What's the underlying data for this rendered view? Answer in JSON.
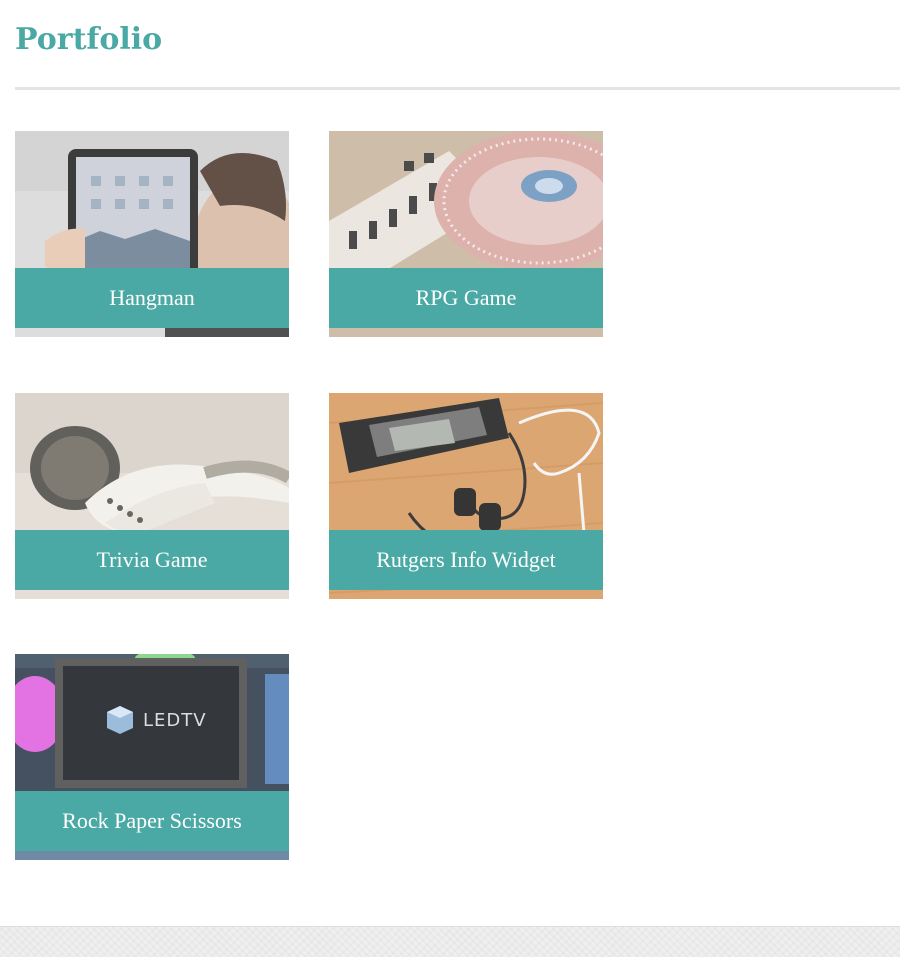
{
  "page": {
    "title": "Portfolio"
  },
  "portfolio": {
    "items": [
      {
        "label": "Hangman",
        "image": "tablet-photo"
      },
      {
        "label": "RPG Game",
        "image": "turntable-photo"
      },
      {
        "label": "Trivia Game",
        "image": "earbuds-photo"
      },
      {
        "label": "Rutgers Info Widget",
        "image": "phone-earphones-photo"
      },
      {
        "label": "Rock Paper Scissors",
        "image": "led-tv-photo",
        "logo_text": "LEDTV"
      }
    ]
  },
  "colors": {
    "accent": "#4aa9a4",
    "caption_text": "#ffffff",
    "rule": "#e4e4e4",
    "footer": "#efefef"
  }
}
